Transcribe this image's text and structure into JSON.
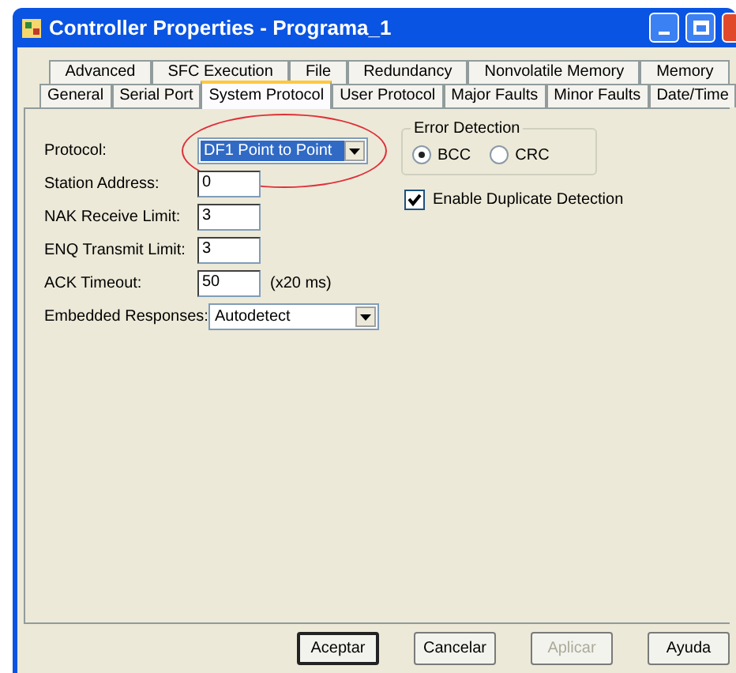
{
  "window": {
    "title": "Controller Properties - Programa_1"
  },
  "tabs_back_row": [
    {
      "label": "Advanced",
      "selected": false
    },
    {
      "label": "SFC Execution",
      "selected": false
    },
    {
      "label": "File",
      "selected": false
    },
    {
      "label": "Redundancy",
      "selected": false
    },
    {
      "label": "Nonvolatile Memory",
      "selected": false
    },
    {
      "label": "Memory",
      "selected": false
    }
  ],
  "tabs_front_row": [
    {
      "label": "General",
      "selected": false
    },
    {
      "label": "Serial Port",
      "selected": false
    },
    {
      "label": "System Protocol",
      "selected": true
    },
    {
      "label": "User Protocol",
      "selected": false
    },
    {
      "label": "Major Faults",
      "selected": false
    },
    {
      "label": "Minor Faults",
      "selected": false
    },
    {
      "label": "Date/Time",
      "selected": false
    }
  ],
  "fields": [
    {
      "kind": "dropdown",
      "label": "Protocol:",
      "value": "DF1 Point to Point",
      "focused": true,
      "circled": true
    },
    {
      "kind": "text",
      "label": "Station Address:",
      "value": "0",
      "focused": false,
      "circled": false
    },
    {
      "kind": "text",
      "label": "NAK Receive Limit:",
      "value": "3",
      "focused": false,
      "circled": false
    },
    {
      "kind": "text",
      "label": "ENQ Transmit Limit:",
      "value": "3",
      "focused": false,
      "circled": false
    },
    {
      "kind": "text",
      "label": "ACK Timeout:",
      "value": "50",
      "unit": "(x20 ms)",
      "focused": false,
      "circled": false
    },
    {
      "kind": "dropdown",
      "label": "Embedded Responses:",
      "value": "Autodetect",
      "focused": false,
      "circled": false
    }
  ],
  "error_detection": {
    "title": "Error Detection",
    "options": [
      {
        "label": "BCC",
        "selected": true
      },
      {
        "label": "CRC",
        "selected": false
      }
    ]
  },
  "duplicate_detection": {
    "label": "Enable Duplicate Detection",
    "checked": true
  },
  "buttons": [
    {
      "label": "Aceptar",
      "default": true,
      "disabled": false
    },
    {
      "label": "Cancelar",
      "default": false,
      "disabled": false
    },
    {
      "label": "Aplicar",
      "default": false,
      "disabled": true
    },
    {
      "label": "Ayuda",
      "default": false,
      "disabled": false
    }
  ]
}
